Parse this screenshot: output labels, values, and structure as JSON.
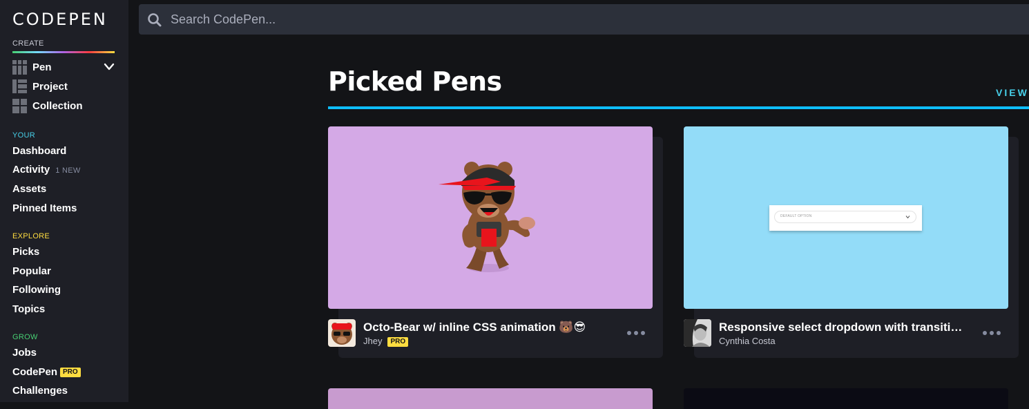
{
  "sidebar": {
    "logo": "CODEPEN",
    "create_label": "CREATE",
    "create_items": [
      {
        "label": "Pen",
        "icon": "pen-grid-icon"
      },
      {
        "label": "Project",
        "icon": "project-grid-icon"
      },
      {
        "label": "Collection",
        "icon": "collection-grid-icon"
      }
    ],
    "your_label": "YOUR",
    "your_items": [
      {
        "label": "Dashboard"
      },
      {
        "label": "Activity",
        "badge": "1 NEW"
      },
      {
        "label": "Assets"
      },
      {
        "label": "Pinned Items"
      }
    ],
    "explore_label": "EXPLORE",
    "explore_items": [
      {
        "label": "Picks"
      },
      {
        "label": "Popular"
      },
      {
        "label": "Following"
      },
      {
        "label": "Topics"
      }
    ],
    "grow_label": "GROW",
    "grow_items": [
      {
        "label": "Jobs"
      },
      {
        "label": "CodePen",
        "badge": "PRO"
      },
      {
        "label": "Challenges"
      }
    ]
  },
  "search": {
    "placeholder": "Search CodePen..."
  },
  "main": {
    "title": "Picked Pens",
    "view_all": "VIEW",
    "cards": [
      {
        "title": "Octo-Bear w/ inline CSS animation 🐻😎",
        "author": "Jhey",
        "author_badge": "PRO",
        "thumb_bg": "#d4a9e6"
      },
      {
        "title": "Responsive select dropdown with transitio…",
        "author": "Cynthia Costa",
        "thumb_bg": "#93dcf8",
        "select_text": "DEFAULT OPTION"
      }
    ]
  },
  "colors": {
    "sidebar_bg": "#1e1f26",
    "page_bg": "#131417",
    "accent": "#0ebeff",
    "your": "#47cfe8",
    "explore": "#ffdd40",
    "grow": "#47cf73",
    "pro": "#ffdd40"
  }
}
